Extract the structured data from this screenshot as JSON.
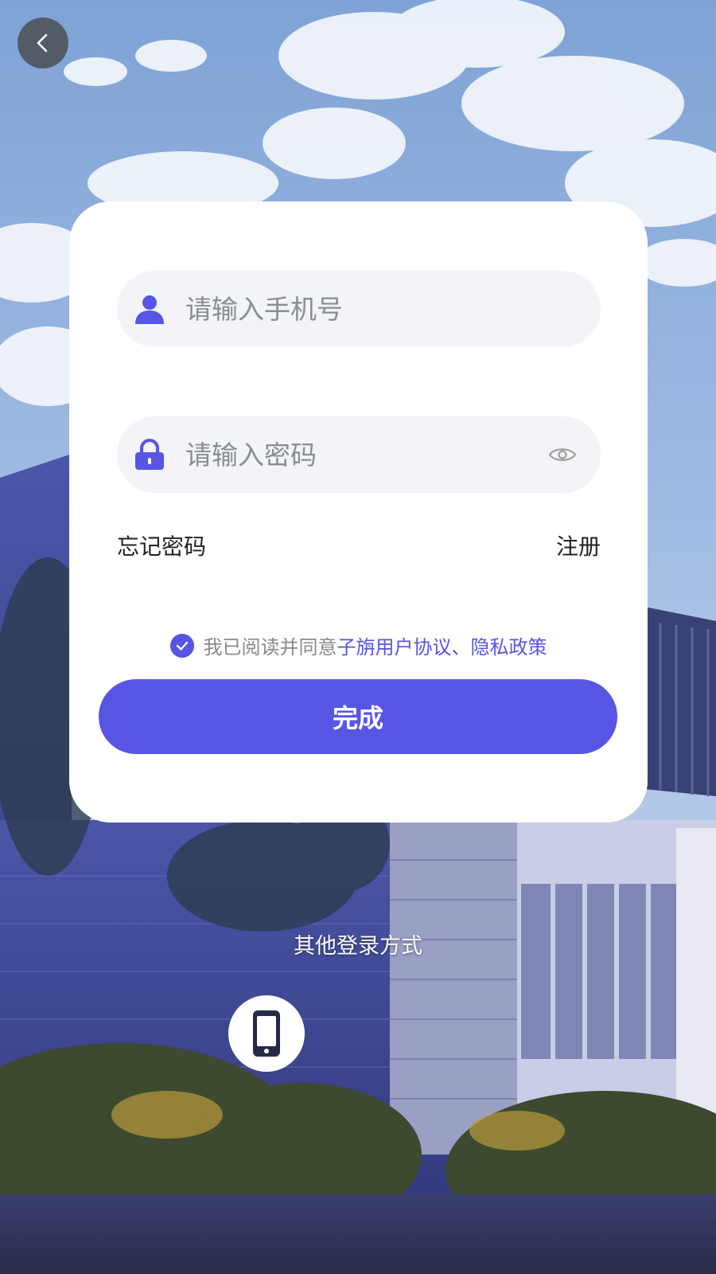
{
  "form": {
    "phone_placeholder": "请输入手机号",
    "password_placeholder": "请输入密码",
    "forgot_label": "忘记密码",
    "register_label": "注册",
    "submit_label": "完成"
  },
  "agreement": {
    "checked": true,
    "prefix": "我已阅读并同意",
    "user_agreement": "子旃用户协议",
    "separator": "、",
    "privacy_policy": "隐私政策"
  },
  "other_login": {
    "title": "其他登录方式",
    "method_icon": "mobile-phone-icon"
  },
  "icons": {
    "back": "chevron-left-icon",
    "user": "user-icon",
    "lock": "lock-icon",
    "eye": "eye-icon",
    "check": "check-icon"
  },
  "colors": {
    "accent": "#5755e3",
    "field_bg": "#f3f4f7",
    "placeholder": "#8a8d93",
    "card_bg": "#ffffff"
  }
}
